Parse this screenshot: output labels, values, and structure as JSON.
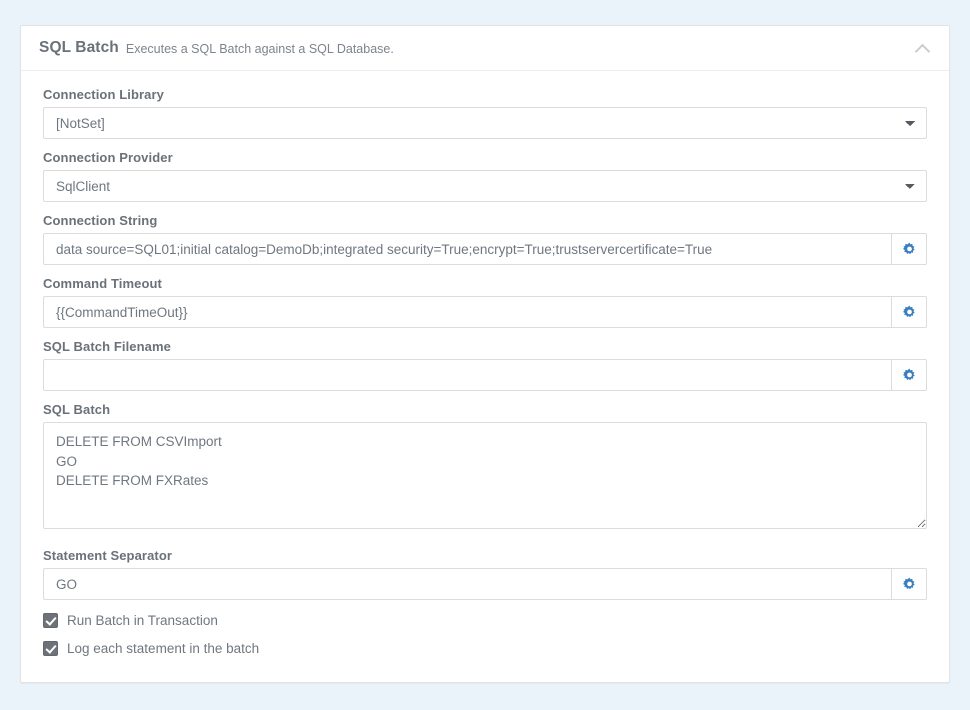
{
  "panel": {
    "title": "SQL Batch",
    "subtitle": "Executes a SQL Batch against a SQL Database.",
    "collapse_icon": "chevron-up-icon",
    "collapse_state": "expanded"
  },
  "fields": {
    "connection_library": {
      "label": "Connection Library",
      "value": "[NotSet]",
      "options": [
        "[NotSet]"
      ],
      "control": "select"
    },
    "connection_provider": {
      "label": "Connection Provider",
      "value": "SqlClient",
      "options": [
        "SqlClient"
      ],
      "control": "select"
    },
    "connection_string": {
      "label": "Connection String",
      "value": "data source=SQL01;initial catalog=DemoDb;integrated security=True;encrypt=True;trustservercertificate=True",
      "placeholder": "",
      "control": "text",
      "addon_icon": "gear-icon"
    },
    "command_timeout": {
      "label": "Command Timeout",
      "value": "{{CommandTimeOut}}",
      "placeholder": "",
      "control": "text",
      "addon_icon": "gear-icon"
    },
    "sql_batch_filename": {
      "label": "SQL Batch Filename",
      "value": "",
      "placeholder": "",
      "control": "text",
      "addon_icon": "gear-icon"
    },
    "sql_batch": {
      "label": "SQL Batch",
      "value": "DELETE FROM CSVImport\nGO\nDELETE FROM FXRates",
      "placeholder": "",
      "control": "textarea"
    },
    "statement_separator": {
      "label": "Statement Separator",
      "value": "GO",
      "placeholder": "",
      "control": "text",
      "addon_icon": "gear-icon"
    }
  },
  "checkboxes": [
    {
      "label": "Run Batch in Transaction",
      "checked": true
    },
    {
      "label": "Log each statement in the batch",
      "checked": true
    }
  ],
  "colors": {
    "page_background": "#eaf2fa",
    "panel_background": "#ffffff",
    "label_text": "#6a7179",
    "value_text": "#6f7780",
    "border": "#dcdcdc",
    "gear_icon": "#3a7ebf",
    "checkbox_fill": "#6d7378",
    "chevron_collapse": "#c9cdd1"
  }
}
